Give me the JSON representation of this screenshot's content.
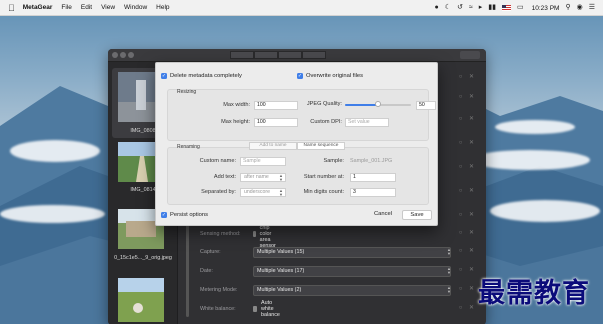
{
  "menubar": {
    "app": "MetaGear",
    "items": [
      "File",
      "Edit",
      "View",
      "Window",
      "Help"
    ],
    "time": "10:23 PM"
  },
  "sidebar": {
    "thumbnails": [
      {
        "label": "IMG_0808"
      },
      {
        "label": "IMG_0814"
      },
      {
        "label": "0_15c1e5..._9_orig.jpeg"
      },
      {
        "label": ""
      }
    ]
  },
  "metadata": {
    "rows": [
      {
        "label": "Sensing method:",
        "value": "One-chip color area sensor"
      },
      {
        "label": "Capture:",
        "value": "Multiple Values (15)"
      },
      {
        "label": "Date:",
        "value": "Multiple Values (17)"
      },
      {
        "label": "Metering Mode:",
        "value": "Multiple Values (2)"
      },
      {
        "label": "White balance:",
        "value": "Auto white balance"
      }
    ]
  },
  "dialog": {
    "delete_metadata": "Delete metadata completely",
    "overwrite_files": "Overwrite original files",
    "resizing": {
      "title": "Resizing",
      "max_width_label": "Max width:",
      "max_width_value": "100",
      "max_height_label": "Max height:",
      "max_height_value": "100",
      "jpeg_quality_label": "JPEG Quality:",
      "jpeg_quality_value": "50",
      "jpeg_quality_fraction": 0.5,
      "custom_dpi_label": "Custom DPI:",
      "custom_dpi_placeholder": "Set value"
    },
    "renaming": {
      "title": "Renaming",
      "tabs": [
        "Add to name",
        "Name sequence"
      ],
      "custom_name_label": "Custom name:",
      "custom_name_placeholder": "Sample",
      "sample_label": "Sample:",
      "sample_value": "Sample_001.JPG",
      "add_text_label": "Add text:",
      "add_text_value": "after name",
      "start_number_label": "Start number at:",
      "start_number_value": "1",
      "separated_by_label": "Separated by:",
      "separated_by_value": "underscore",
      "min_digits_label": "Min digits count:",
      "min_digits_value": "3"
    },
    "persist_options": "Persist options",
    "cancel": "Cancel",
    "save": "Save"
  },
  "watermark": "最需教育",
  "colors": {
    "accent": "#3f7ee8",
    "window_bg": "#303033",
    "dialog_bg": "#ececec",
    "watermark": "#0b0b7a"
  }
}
